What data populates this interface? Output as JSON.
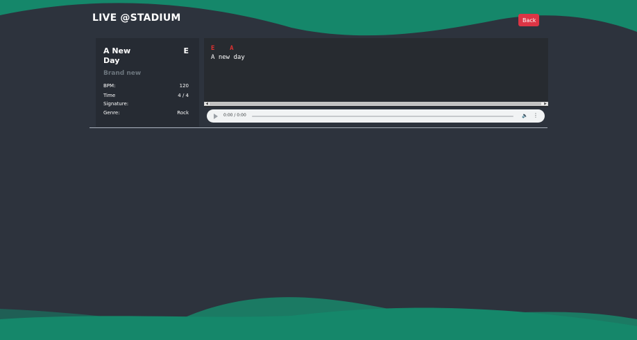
{
  "header": {
    "title": "LIVE @STADIUM",
    "back_label": "Back"
  },
  "song": {
    "title": "A New Day",
    "key": "E",
    "subtitle": "Brand new",
    "meta": [
      {
        "label": "BPM:",
        "value": "120"
      },
      {
        "label": "Time Signature:",
        "value": "4 / 4"
      },
      {
        "label": "Genre:",
        "value": "Rock"
      }
    ]
  },
  "sheet": {
    "chords": "E    A",
    "lyrics": "A new day"
  },
  "player": {
    "time": "0:00 / 0:00",
    "play_icon": "play-icon",
    "volume_icon": "volume-icon",
    "more_icon": "more-vertical-icon"
  },
  "colors": {
    "background": "#2d333d",
    "wave": "#15876a",
    "accent_red": "#dc3545",
    "chord_red": "#e03131"
  }
}
